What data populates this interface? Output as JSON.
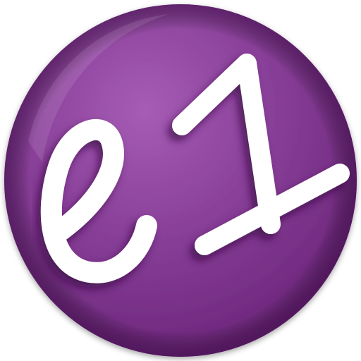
{
  "icon": {
    "name": "e1-app-icon",
    "logo_text": "e1",
    "colors": {
      "disc": "#843b94",
      "disc_highlight": "#a65cb5",
      "disc_rim_shadow": "#4a1556",
      "glyph": "#ffffff",
      "glyph_shadow": "#3a0d44"
    }
  }
}
